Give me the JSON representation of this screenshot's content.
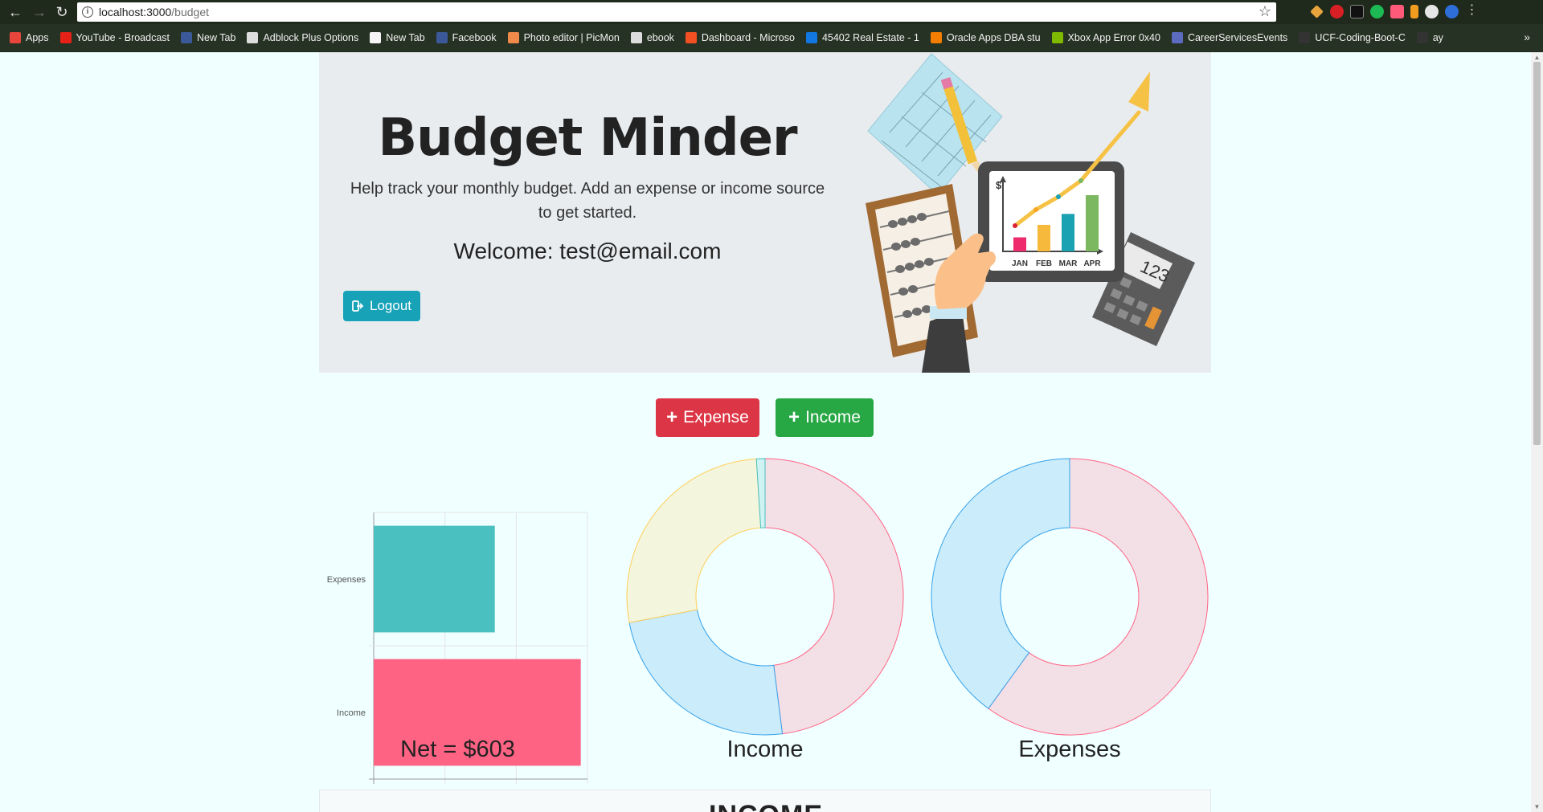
{
  "browser": {
    "url_host": "localhost:3000",
    "url_path": "/budget",
    "bookmarks": [
      {
        "label": "Apps",
        "icon": "apps-grid-icon",
        "color": "#e8453c"
      },
      {
        "label": "YouTube - Broadcast",
        "icon": "youtube-icon",
        "color": "#e62117"
      },
      {
        "label": "New Tab",
        "icon": "facebook-icon",
        "color": "#3b5998"
      },
      {
        "label": "Adblock Plus Options",
        "icon": "page-icon",
        "color": "#dddddd"
      },
      {
        "label": "New Tab",
        "icon": "hexagon-icon",
        "color": "#f5f5f5"
      },
      {
        "label": "Facebook",
        "icon": "facebook-icon",
        "color": "#3b5998"
      },
      {
        "label": "Photo editor | PicMon",
        "icon": "picmonkey-icon",
        "color": "#f08a4b"
      },
      {
        "label": "ebook",
        "icon": "page-icon",
        "color": "#dddddd"
      },
      {
        "label": "Dashboard - Microso",
        "icon": "microsoft-icon",
        "color": "#f25022"
      },
      {
        "label": "45402 Real Estate - 1",
        "icon": "zillow-icon",
        "color": "#1277e1"
      },
      {
        "label": "Oracle Apps DBA stu",
        "icon": "blogger-icon",
        "color": "#f57d00"
      },
      {
        "label": "Xbox App Error 0x40",
        "icon": "microsoft-icon",
        "color": "#7fba00"
      },
      {
        "label": "CareerServicesEvents",
        "icon": "calendar-icon",
        "color": "#5c6bc0"
      },
      {
        "label": "UCF-Coding-Boot-C",
        "icon": "github-icon",
        "color": "#333333"
      },
      {
        "label": "ay",
        "icon": "github-icon",
        "color": "#333333"
      }
    ],
    "overflow_label": "»"
  },
  "header": {
    "title": "Budget Minder",
    "lead": "Help track your monthly budget. Add an expense or income source to get started.",
    "welcome": "Welcome: test@email.com",
    "logout_label": "Logout"
  },
  "actions": {
    "expense_label": "Expense",
    "income_label": "Income"
  },
  "net_label": "Net = $603",
  "income_chart_title": "Income",
  "expenses_chart_title": "Expenses",
  "bottom_section_title": "INCOME",
  "colors": {
    "teal": "#4bc0c0",
    "pink": "#ff6384",
    "blue": "#36a2eb",
    "yellow": "#ffce56",
    "logout": "#17a2b8",
    "expense_btn": "#dc3545",
    "income_btn": "#28a745"
  },
  "chart_data": [
    {
      "type": "bar",
      "orientation": "horizontal",
      "categories": [
        "Expenses",
        "Income"
      ],
      "values": [
        850,
        1453
      ],
      "colors": [
        "#4bc0c0",
        "#ff6384"
      ],
      "xlim": [
        0,
        1500
      ],
      "xticks": [
        0,
        500,
        1000,
        1500
      ],
      "grid": true,
      "title": ""
    },
    {
      "type": "pie",
      "style": "doughnut",
      "title": "Income",
      "slices": [
        {
          "value": 48,
          "color": "#ff6384"
        },
        {
          "value": 24,
          "color": "#36a2eb"
        },
        {
          "value": 27,
          "color": "#ffce56"
        },
        {
          "value": 1,
          "color": "#4bc0c0"
        }
      ]
    },
    {
      "type": "pie",
      "style": "doughnut",
      "title": "Expenses",
      "slices": [
        {
          "value": 60,
          "color": "#ff6384"
        },
        {
          "value": 40,
          "color": "#36a2eb"
        }
      ]
    }
  ],
  "illustration": {
    "month_labels": [
      "JAN",
      "FEB",
      "MAR",
      "APR"
    ],
    "month_values": [
      18,
      34,
      48,
      72
    ],
    "bar_colors": [
      "#ee2b6c",
      "#f6b93b",
      "#1aa2b3",
      "#7cb85f"
    ],
    "axis_symbol": "$",
    "calculator_display": "123"
  }
}
